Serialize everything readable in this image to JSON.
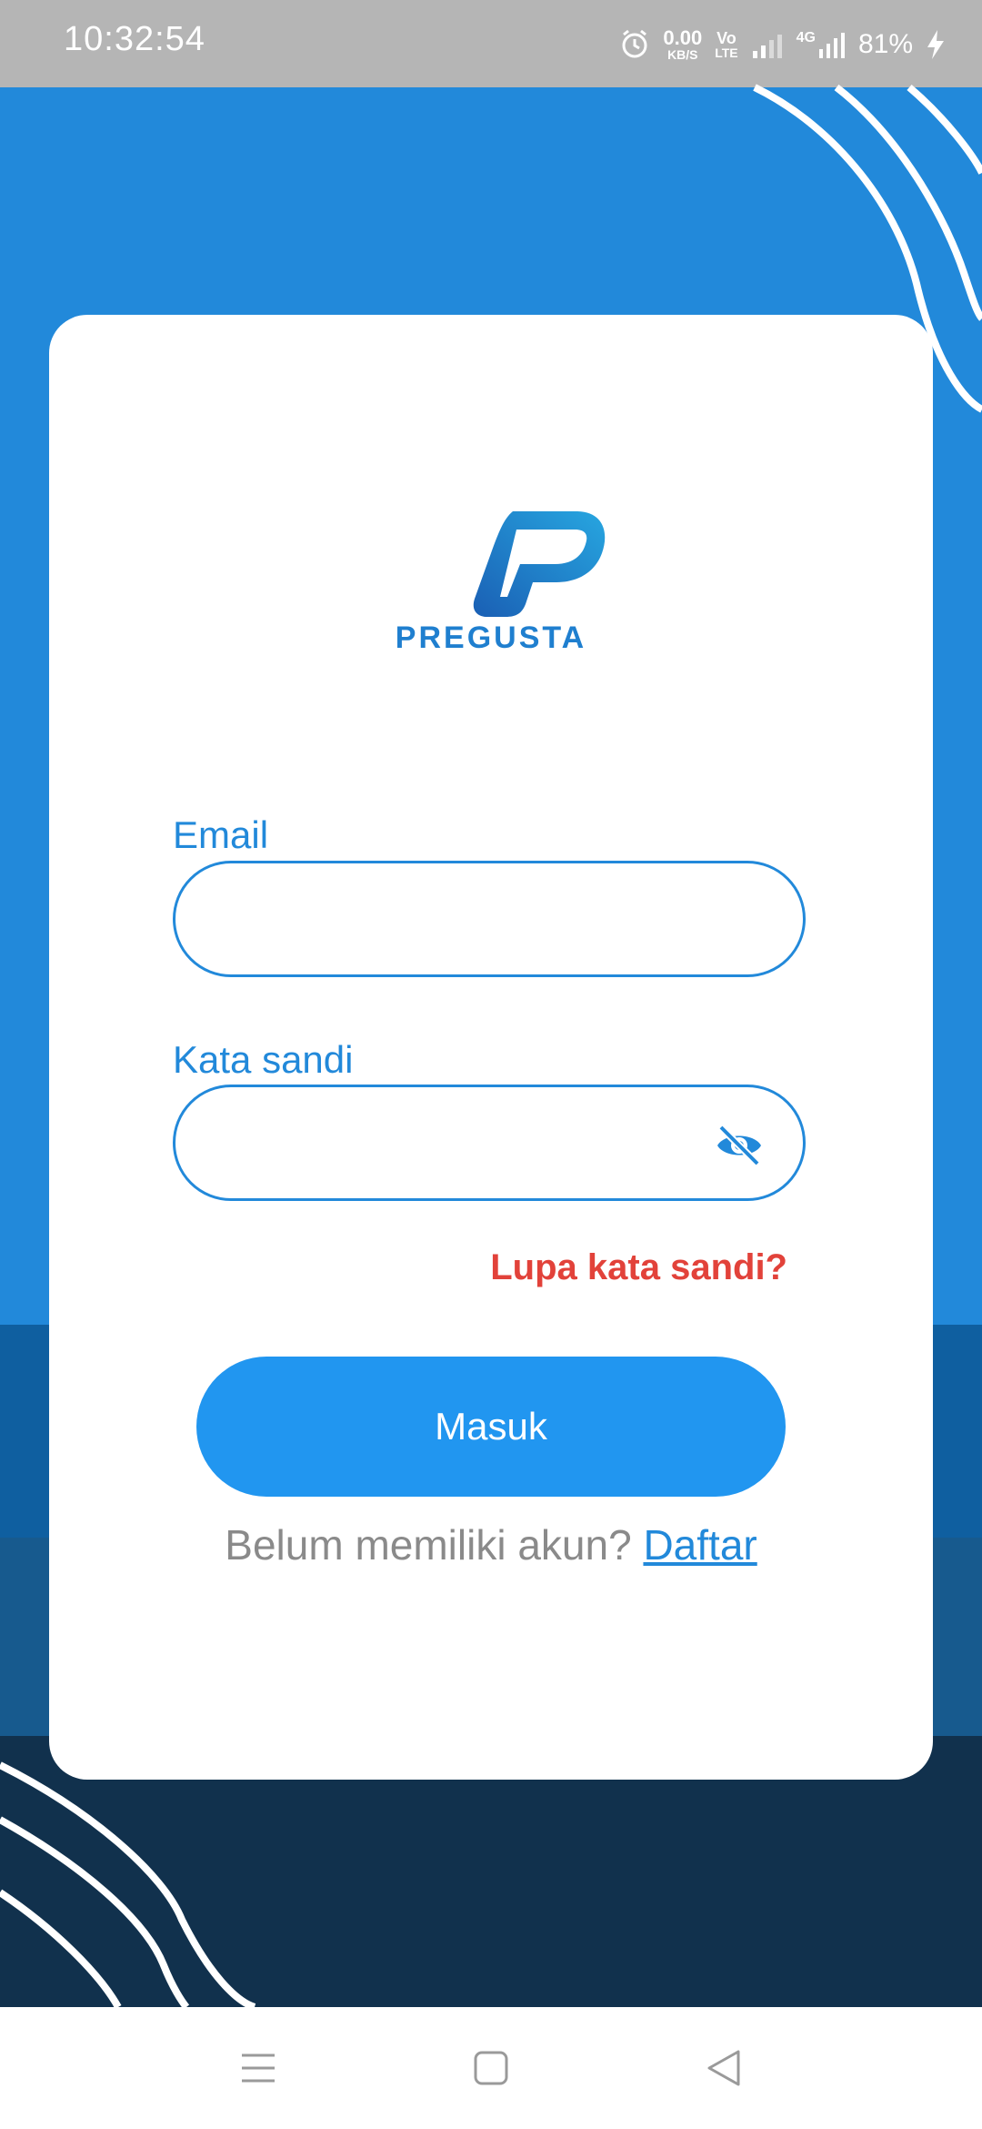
{
  "status_bar": {
    "time": "10:32:54",
    "net_speed_value": "0.00",
    "net_speed_unit": "KB/S",
    "volte_top": "Vo",
    "volte_bottom": "LTE",
    "network_type": "4G",
    "battery": "81%",
    "icons": [
      "alarm-icon",
      "signal-icon",
      "signal-4g-icon",
      "charging-icon"
    ]
  },
  "brand": {
    "name": "PREGUSTA",
    "logo": "pregusta-p-logo"
  },
  "form": {
    "email_label": "Email",
    "email_value": "",
    "password_label": "Kata sandi",
    "password_value": "",
    "password_toggle_icon": "eye-off-icon",
    "forgot_label": "Lupa kata sandi?",
    "submit_label": "Masuk",
    "register_prompt": "Belum memiliki akun?",
    "register_link": "Daftar"
  },
  "nav_bar": {
    "icons": [
      "menu-icon",
      "home-square-icon",
      "back-triangle-icon"
    ]
  },
  "colors": {
    "primary": "#2289da",
    "button": "#2196f0",
    "forgot": "#e2423a",
    "dark_band": "#11314d"
  }
}
